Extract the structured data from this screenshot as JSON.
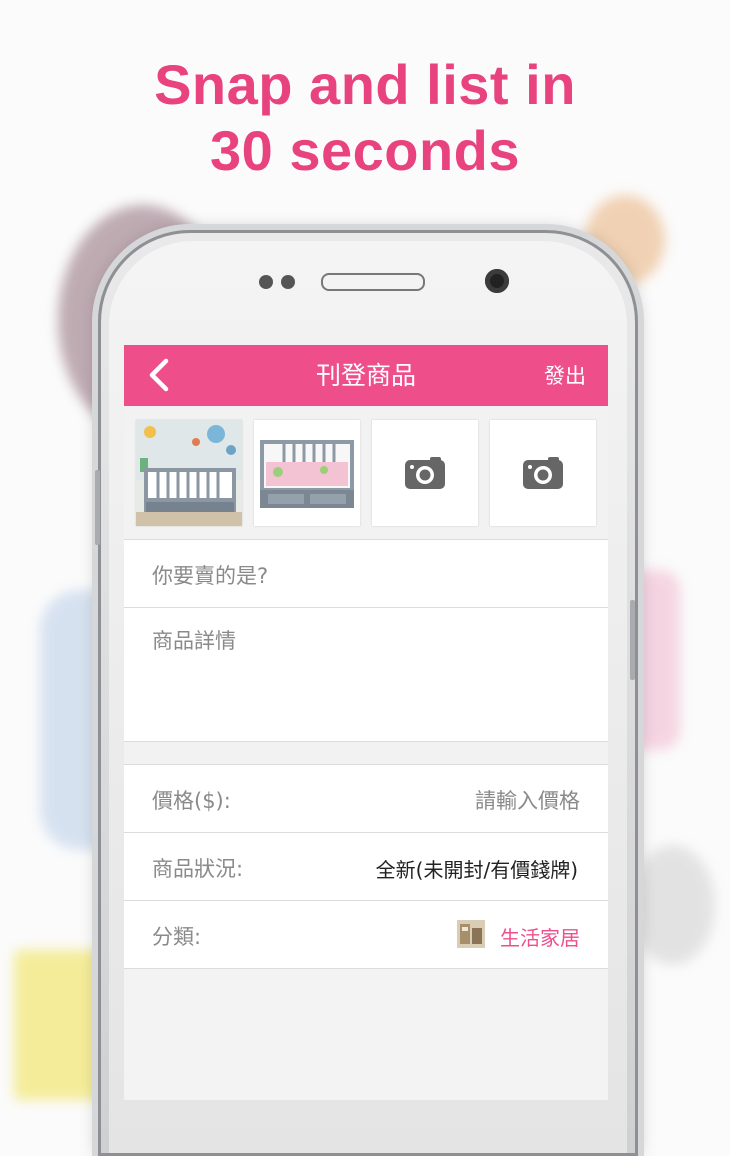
{
  "headline": {
    "line1": "Snap and list in",
    "line2": "30 seconds"
  },
  "appbar": {
    "back_icon": "chevron-left-icon",
    "title": "刊登商品",
    "logout_label": "發出"
  },
  "photos": [
    {
      "kind": "photo",
      "subject": "gray crib"
    },
    {
      "kind": "photo",
      "subject": "gray toddler bed"
    },
    {
      "kind": "placeholder",
      "icon": "camera-icon"
    },
    {
      "kind": "placeholder",
      "icon": "camera-icon"
    }
  ],
  "form": {
    "title_placeholder": "你要賣的是?",
    "details_placeholder": "商品詳情",
    "price_label": "價格($):",
    "price_placeholder": "請輸入價格",
    "condition_label": "商品狀況:",
    "condition_value": "全新(未開封/有價錢牌)",
    "category_label": "分類:",
    "category_value": "生活家居"
  },
  "colors": {
    "accent": "#ee4f8b",
    "headline": "#e8437e",
    "placeholder": "#8a8a8a"
  }
}
